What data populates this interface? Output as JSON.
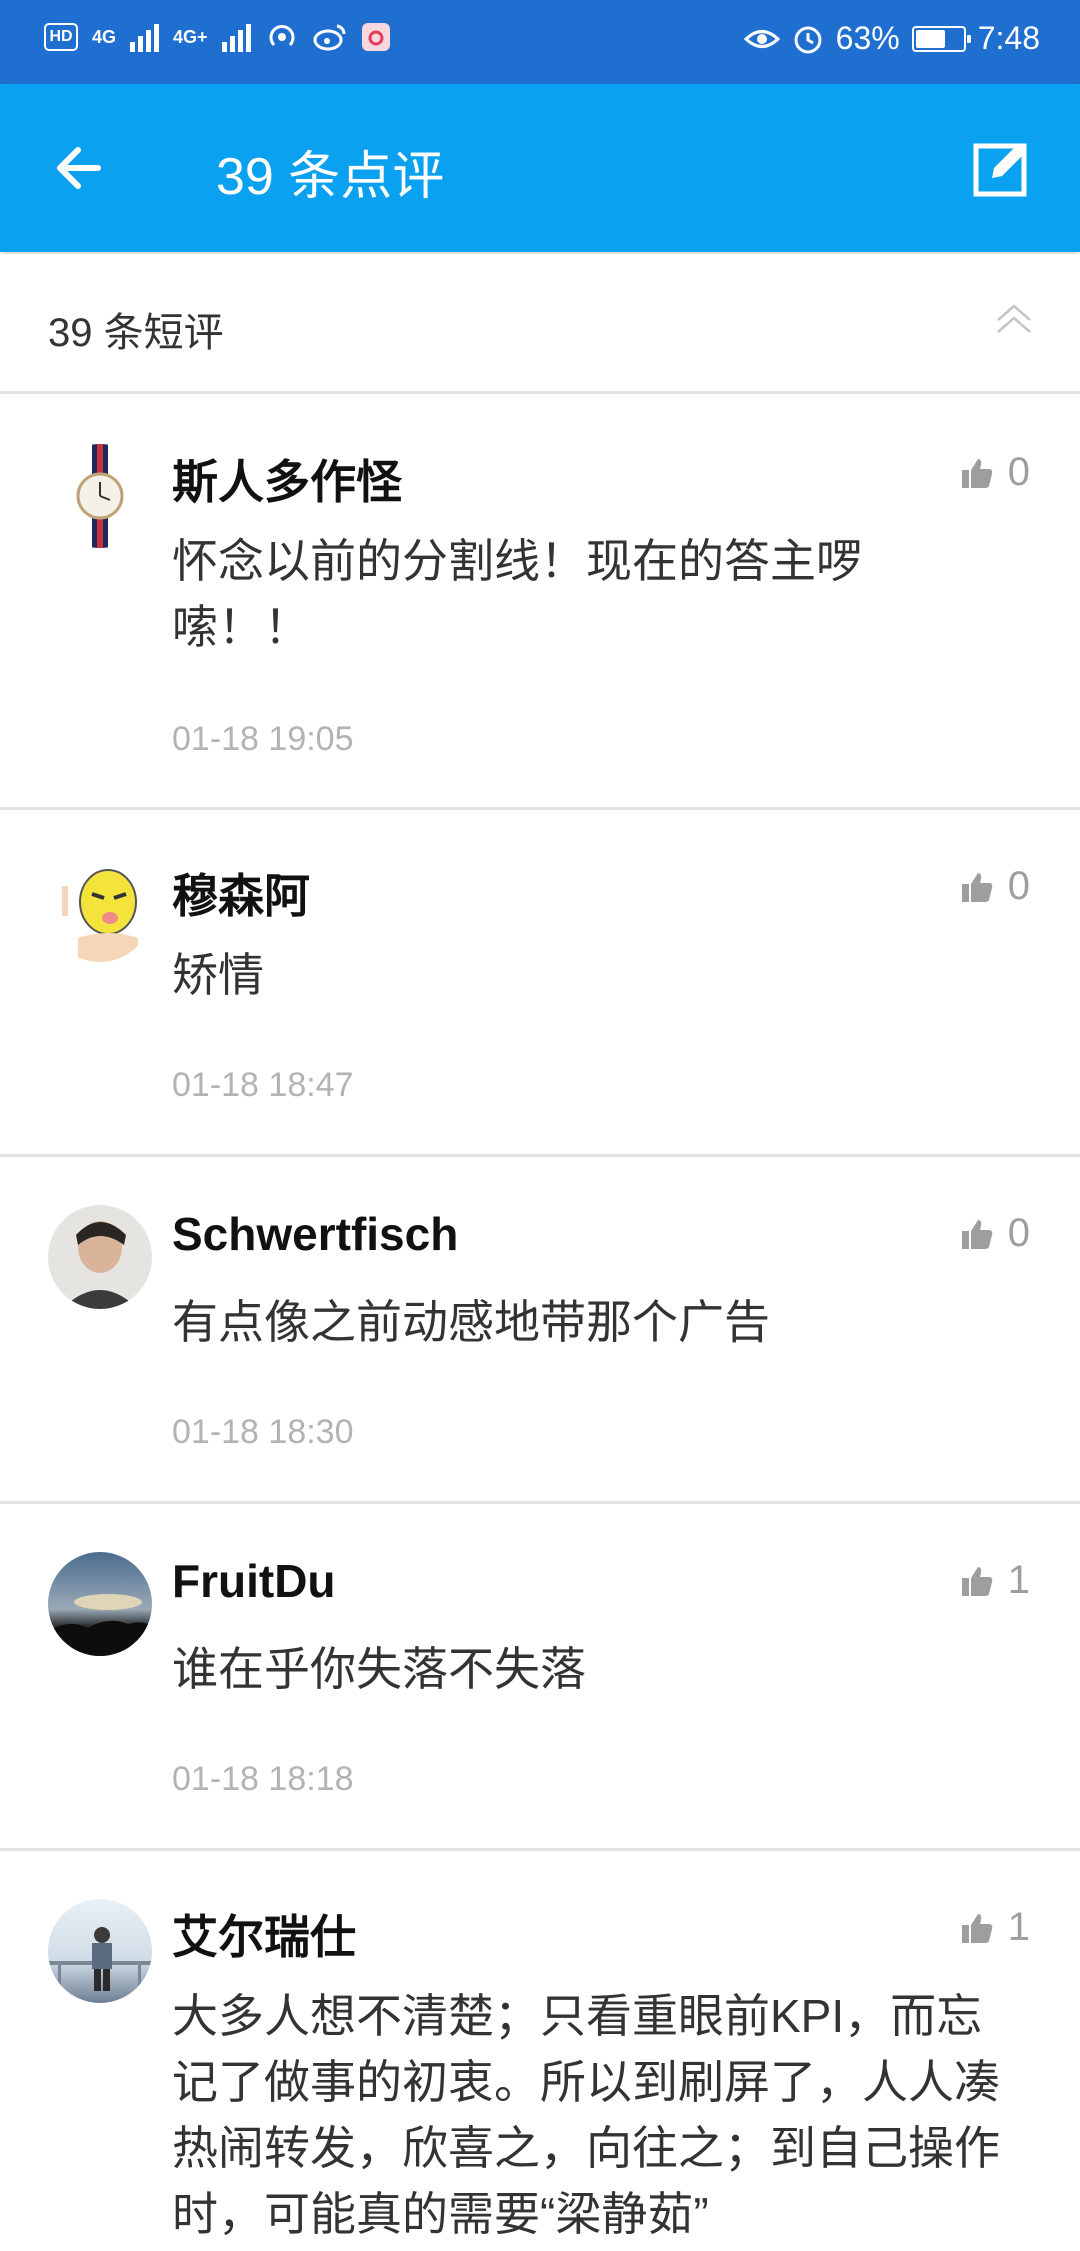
{
  "status_bar": {
    "network_hd": "HD",
    "signal1": "4G",
    "signal2": "4G+",
    "battery_percent": "63%",
    "battery_level": 0.63,
    "time": "7:48"
  },
  "app_bar": {
    "title": "39 条点评"
  },
  "subheader": {
    "label": "39 条短评"
  },
  "comments": [
    {
      "name": "斯人多作怪",
      "text": "怀念以前的分割线！现在的答主啰嗦！！",
      "time": "01-18 19:05",
      "likes": "0"
    },
    {
      "name": "穆森阿",
      "text": "矫情",
      "time": "01-18 18:47",
      "likes": "0"
    },
    {
      "name": "Schwertfisch",
      "text": "有点像之前动感地带那个广告",
      "time": "01-18 18:30",
      "likes": "0"
    },
    {
      "name": "FruitDu",
      "text": "谁在乎你失落不失落",
      "time": "01-18 18:18",
      "likes": "1"
    },
    {
      "name": "艾尔瑞仕",
      "text": "大多人想不清楚；只看重眼前KPI，而忘记了做事的初衷。所以到刷屏了，人人凑热闹转发，欣喜之，向往之；到自己操作时，可能真的需要“梁静茹”",
      "time": "",
      "likes": "1"
    }
  ],
  "colors": {
    "status_bar": "#1f6fd1",
    "app_bar": "#0aa1f0",
    "divider": "#e3e3e3",
    "timestamp": "#b3b3b3",
    "like_icon": "#9e9e9e"
  },
  "icons": {
    "back": "arrow-left-icon",
    "edit": "edit-icon",
    "collapse": "chevron-up-double-icon",
    "like": "thumbs-up-icon"
  }
}
